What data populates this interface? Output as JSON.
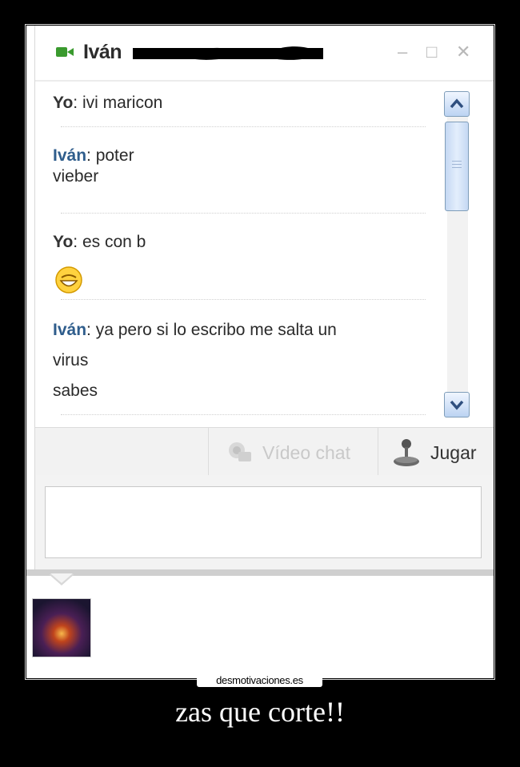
{
  "window": {
    "title": "Iván",
    "controls": {
      "minimize": "–",
      "maximize": "□",
      "close": "✕"
    }
  },
  "messages": [
    {
      "sender": "Yo",
      "lines": [
        "ivi maricon"
      ]
    },
    {
      "sender": "Iván",
      "lines": [
        "poter",
        "vieber"
      ]
    },
    {
      "sender": "Yo",
      "lines": [
        "es con b"
      ],
      "emoticon": "grin-icon"
    },
    {
      "sender": "Iván",
      "lines": [
        "ya pero si lo escribo me salta un",
        "virus",
        "sabes"
      ]
    }
  ],
  "toolbar": {
    "video_chat": "Vídeo chat",
    "play": "Jugar"
  },
  "input": {
    "value": ""
  },
  "footer": {
    "watermark": "desmotivaciones.es",
    "caption": "zas que corte!!"
  },
  "colors": {
    "ivan_name": "#2f5d8c",
    "accent_green": "#3a9a2e",
    "scroll_blue": "#7f9db9"
  }
}
